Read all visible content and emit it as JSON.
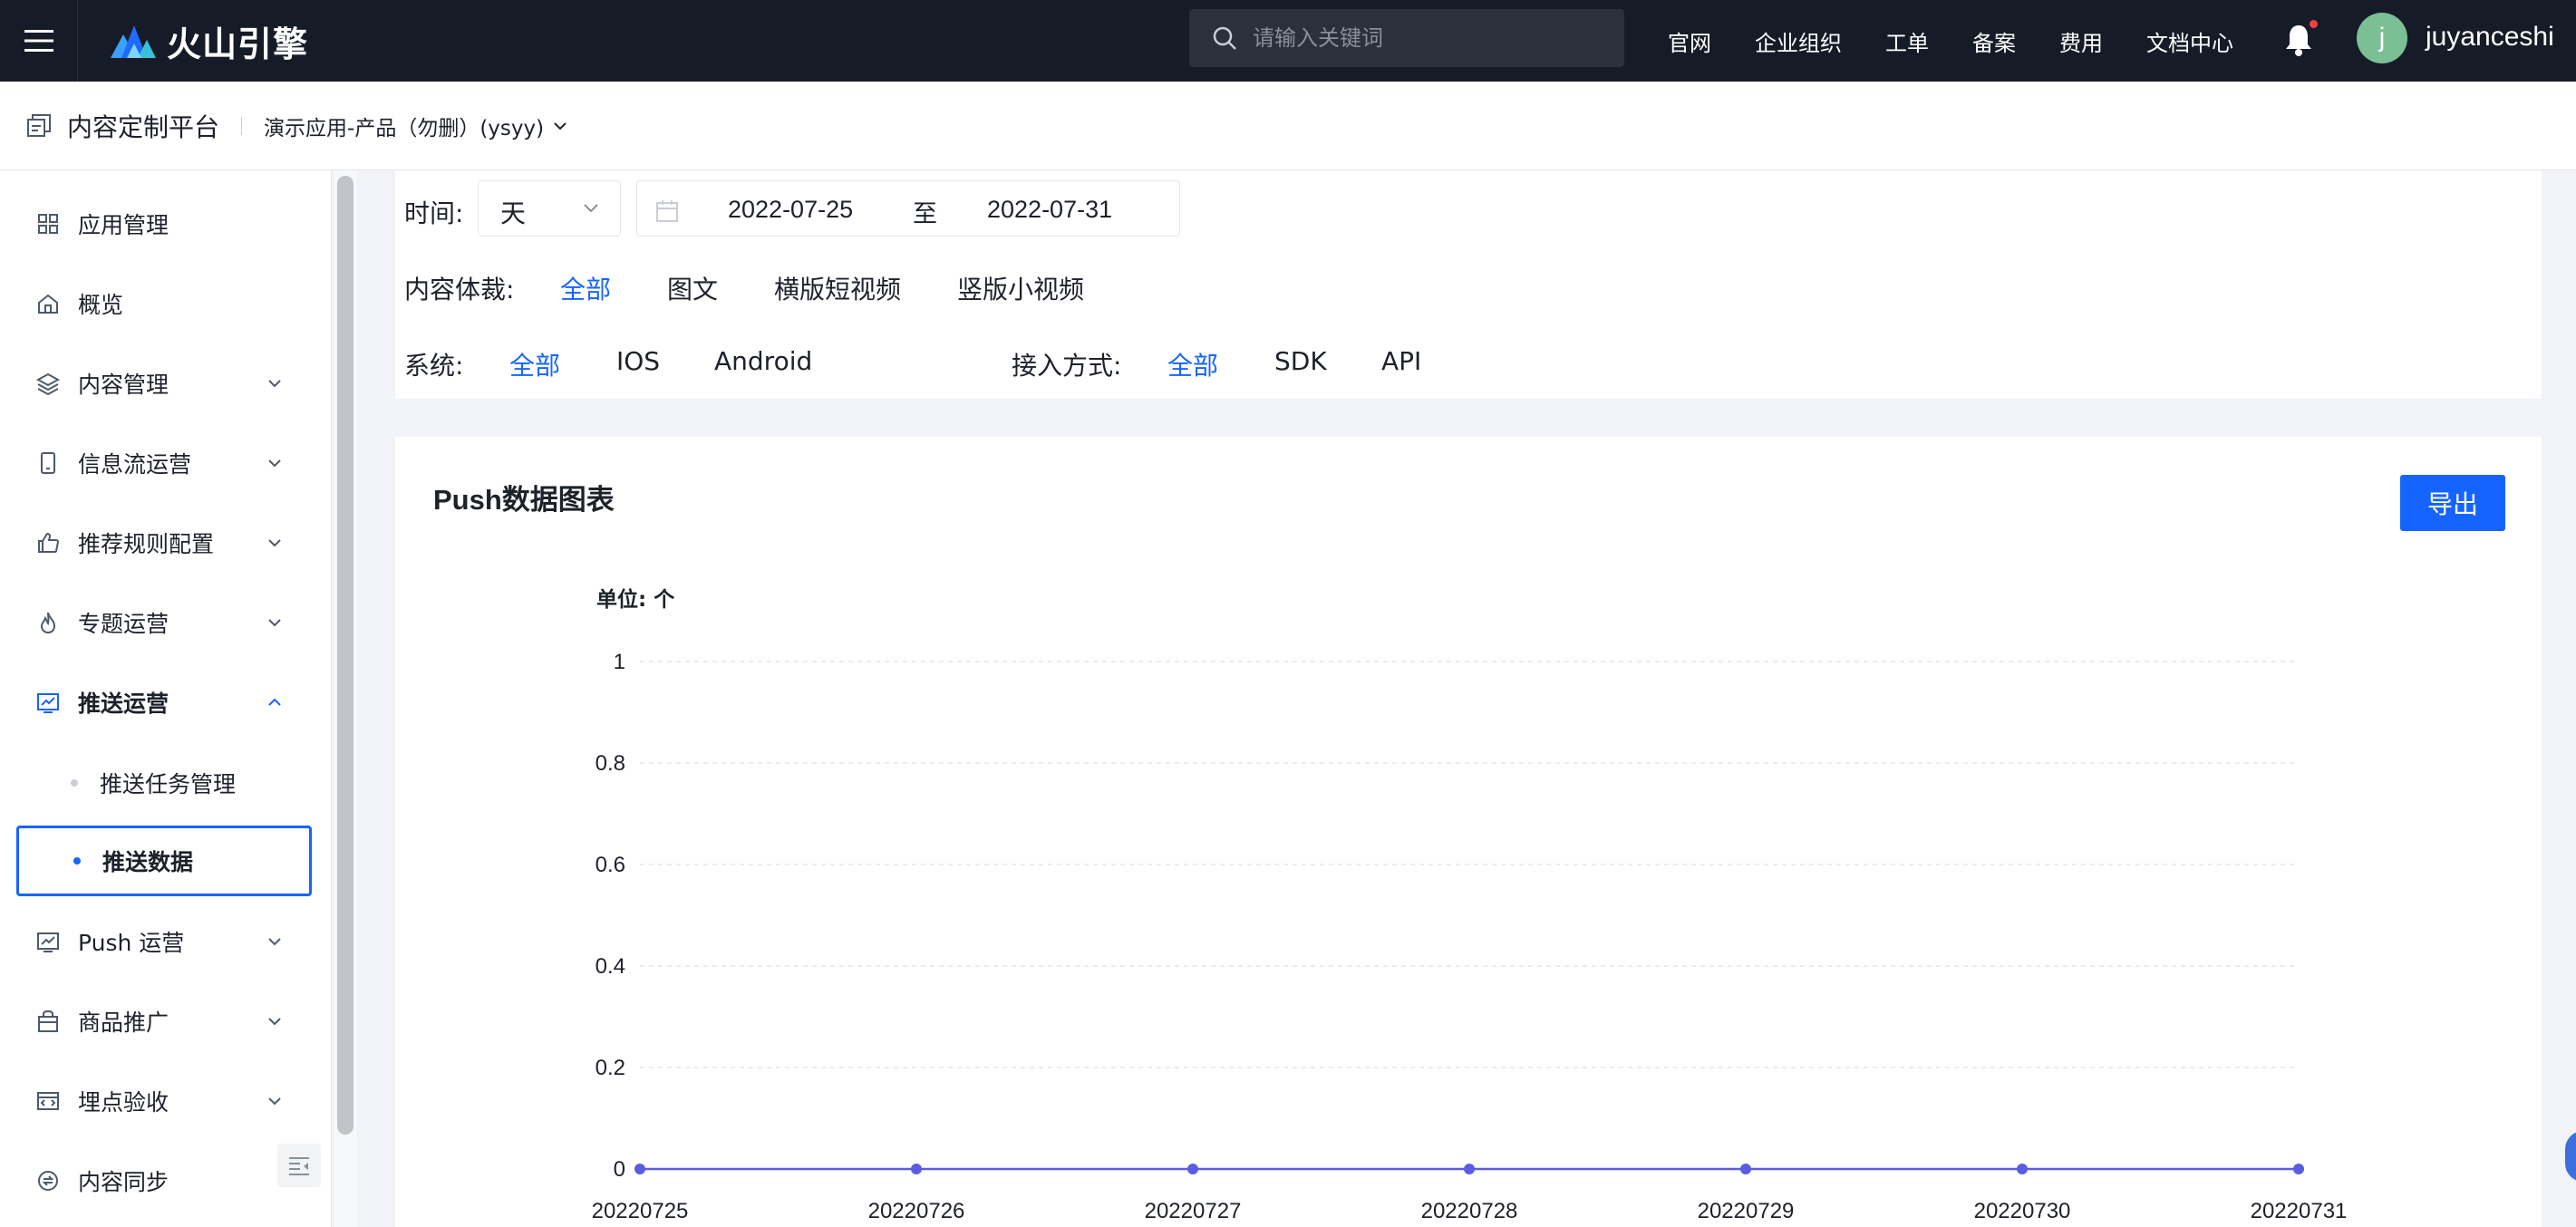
{
  "topbar": {
    "brand": "火山引擎",
    "search_placeholder": "请输入关键词",
    "nav": [
      "官网",
      "企业组织",
      "工单",
      "备案",
      "费用",
      "文档中心"
    ],
    "avatar_letter": "j",
    "username": "juyanceshi"
  },
  "subheader": {
    "platform": "内容定制平台",
    "app": "演示应用-产品（勿删）(ysyy)"
  },
  "sidebar": {
    "items": [
      {
        "label": "应用管理",
        "icon": "grid-icon",
        "expandable": false
      },
      {
        "label": "概览",
        "icon": "home-icon",
        "expandable": false
      },
      {
        "label": "内容管理",
        "icon": "layers-icon",
        "expandable": true
      },
      {
        "label": "信息流运营",
        "icon": "phone-icon",
        "expandable": true
      },
      {
        "label": "推荐规则配置",
        "icon": "thumbs-up-icon",
        "expandable": true
      },
      {
        "label": "专题运营",
        "icon": "flame-icon",
        "expandable": true
      },
      {
        "label": "推送运营",
        "icon": "push-icon",
        "expandable": true,
        "expanded": true
      },
      {
        "label": "Push 运营",
        "icon": "push-icon",
        "expandable": true
      },
      {
        "label": "商品推广",
        "icon": "bag-icon",
        "expandable": true
      },
      {
        "label": "埋点验收",
        "icon": "code-window-icon",
        "expandable": true
      },
      {
        "label": "内容同步",
        "icon": "sync-icon",
        "expandable": false
      }
    ],
    "sub_items": [
      "推送任务管理",
      "推送数据"
    ],
    "selected_sub_item": "推送数据"
  },
  "filters": {
    "time_label": "时间:",
    "granularity": "天",
    "date_start": "2022-07-25",
    "date_sep": "至",
    "date_end": "2022-07-31",
    "content_label": "内容体裁:",
    "content_options": [
      "全部",
      "图文",
      "横版短视频",
      "竖版小视频"
    ],
    "content_selected": "全部",
    "system_label": "系统:",
    "system_options": [
      "全部",
      "IOS",
      "Android"
    ],
    "system_selected": "全部",
    "access_label": "接入方式:",
    "access_options": [
      "全部",
      "SDK",
      "API"
    ],
    "access_selected": "全部"
  },
  "chart_card": {
    "title": "Push数据图表",
    "export_label": "导出",
    "unit_label": "单位: 个"
  },
  "colors": {
    "accent": "#1664ff",
    "series": "#5b5ce2",
    "topbar": "#161c27"
  },
  "chart_data": {
    "type": "line",
    "x": [
      "20220725",
      "20220726",
      "20220727",
      "20220728",
      "20220729",
      "20220730",
      "20220731"
    ],
    "series": [
      {
        "values": [
          0,
          0,
          0,
          0,
          0,
          0,
          0
        ]
      }
    ],
    "yticks": [
      "0",
      "0.2",
      "0.4",
      "0.6",
      "0.8",
      "1"
    ],
    "ylim": [
      0,
      1
    ],
    "grid": true
  }
}
